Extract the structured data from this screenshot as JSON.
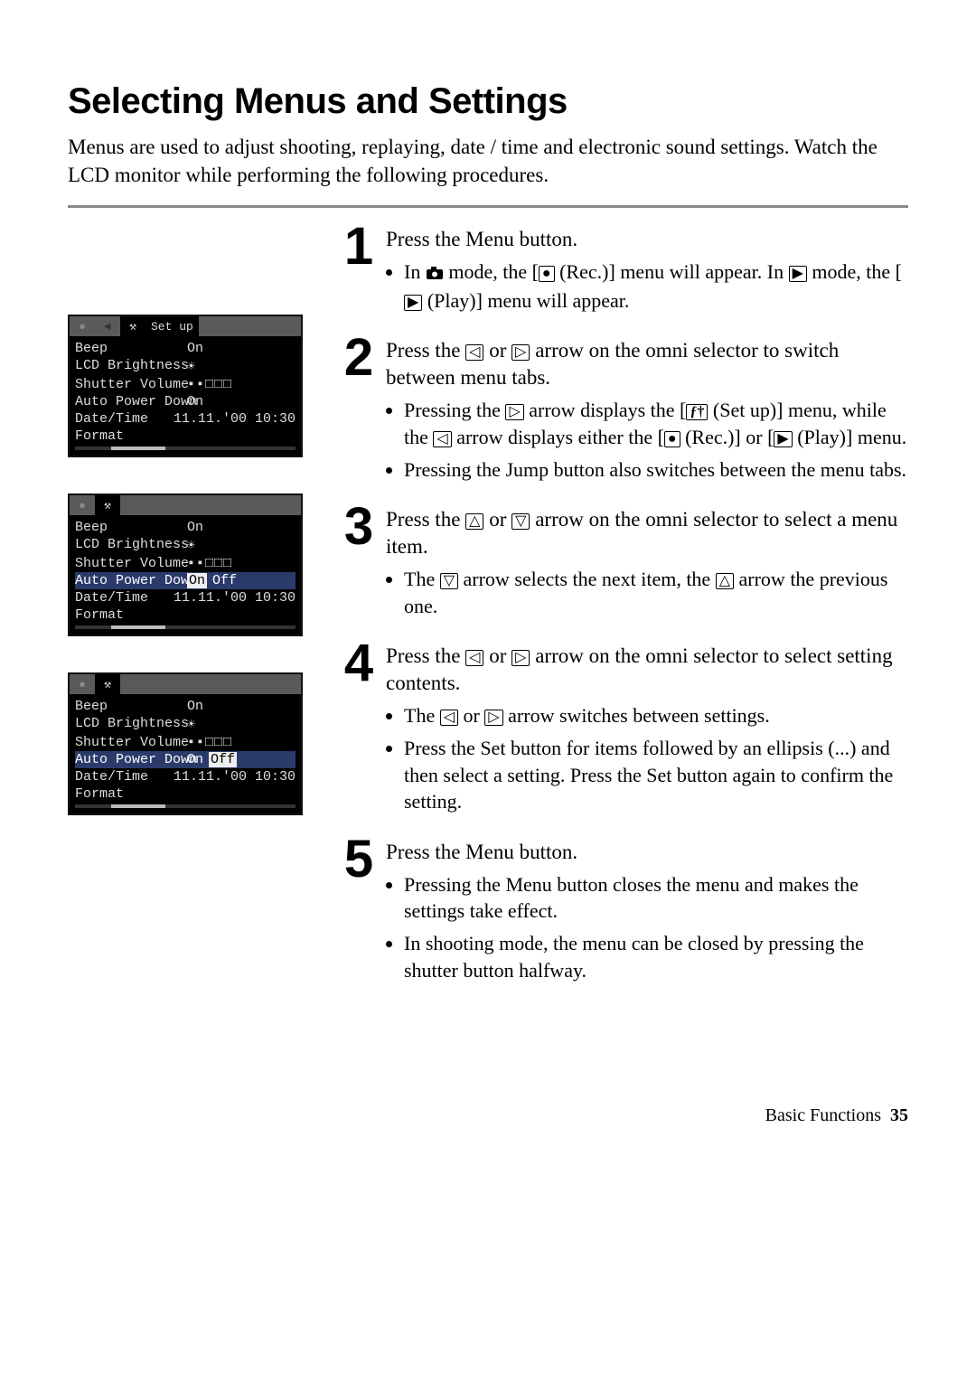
{
  "title": "Selecting Menus and Settings",
  "intro": "Menus are used to adjust shooting, replaying, date / time and electronic sound settings. Watch the LCD monitor while performing the following procedures.",
  "steps": [
    {
      "num": "1",
      "head": "Press the Menu button.",
      "bullets": [
        "In {camera-icon} mode, the [{rec-icon} (Rec.)] menu will appear. In {play-icon} mode, the [{play-box-icon} (Play)] menu will appear."
      ]
    },
    {
      "num": "2",
      "head": "Press the {left-box} or {right-box} arrow on the omni selector to switch between menu tabs.",
      "bullets": [
        "Pressing the {right-box} arrow displays the [{tools-icon} (Set up)] menu, while the {left-box} arrow displays either the [{rec-icon} (Rec.)] or [{play-box-icon} (Play)] menu.",
        "Pressing the Jump button also switches between the menu tabs."
      ]
    },
    {
      "num": "3",
      "head": "Press the {up-box} or {down-box} arrow on the omni selector to select a menu item.",
      "bullets": [
        "The {down-box} arrow selects the next item, the {up-box} arrow the previous one."
      ]
    },
    {
      "num": "4",
      "head": "Press the {left-box} or {right-box} arrow on the omni selector to select setting contents.",
      "bullets": [
        "The {left-box} or {right-box} arrow switches between settings.",
        "Press the Set button for items followed by an ellipsis (...) and then select a setting. Press the Set button again to confirm the setting."
      ]
    },
    {
      "num": "5",
      "head": "Press the Menu button.",
      "bullets": [
        "Pressing the Menu button closes the menu and makes the settings take effect.",
        "In shooting mode, the menu can be closed by pressing the shutter button halfway."
      ]
    }
  ],
  "lcd_tabs": {
    "tab1": "●",
    "tab2": "◄",
    "tab3": "⚒",
    "setup_label": "Set up"
  },
  "lcd_common": {
    "beep": "Beep",
    "beep_val": "On",
    "bright": "LCD Brightness",
    "bright_val": "☀",
    "shutter": "Shutter Volume",
    "shutter_val": "▪▪□□□",
    "apd": "Auto Power Down",
    "apd_on": "On",
    "apd_off": "Off",
    "dt": "Date/Time",
    "dt_val": "11.11.'00 10:30",
    "fmt": "Format"
  },
  "footer_section": "Basic Functions",
  "footer_page": "35"
}
